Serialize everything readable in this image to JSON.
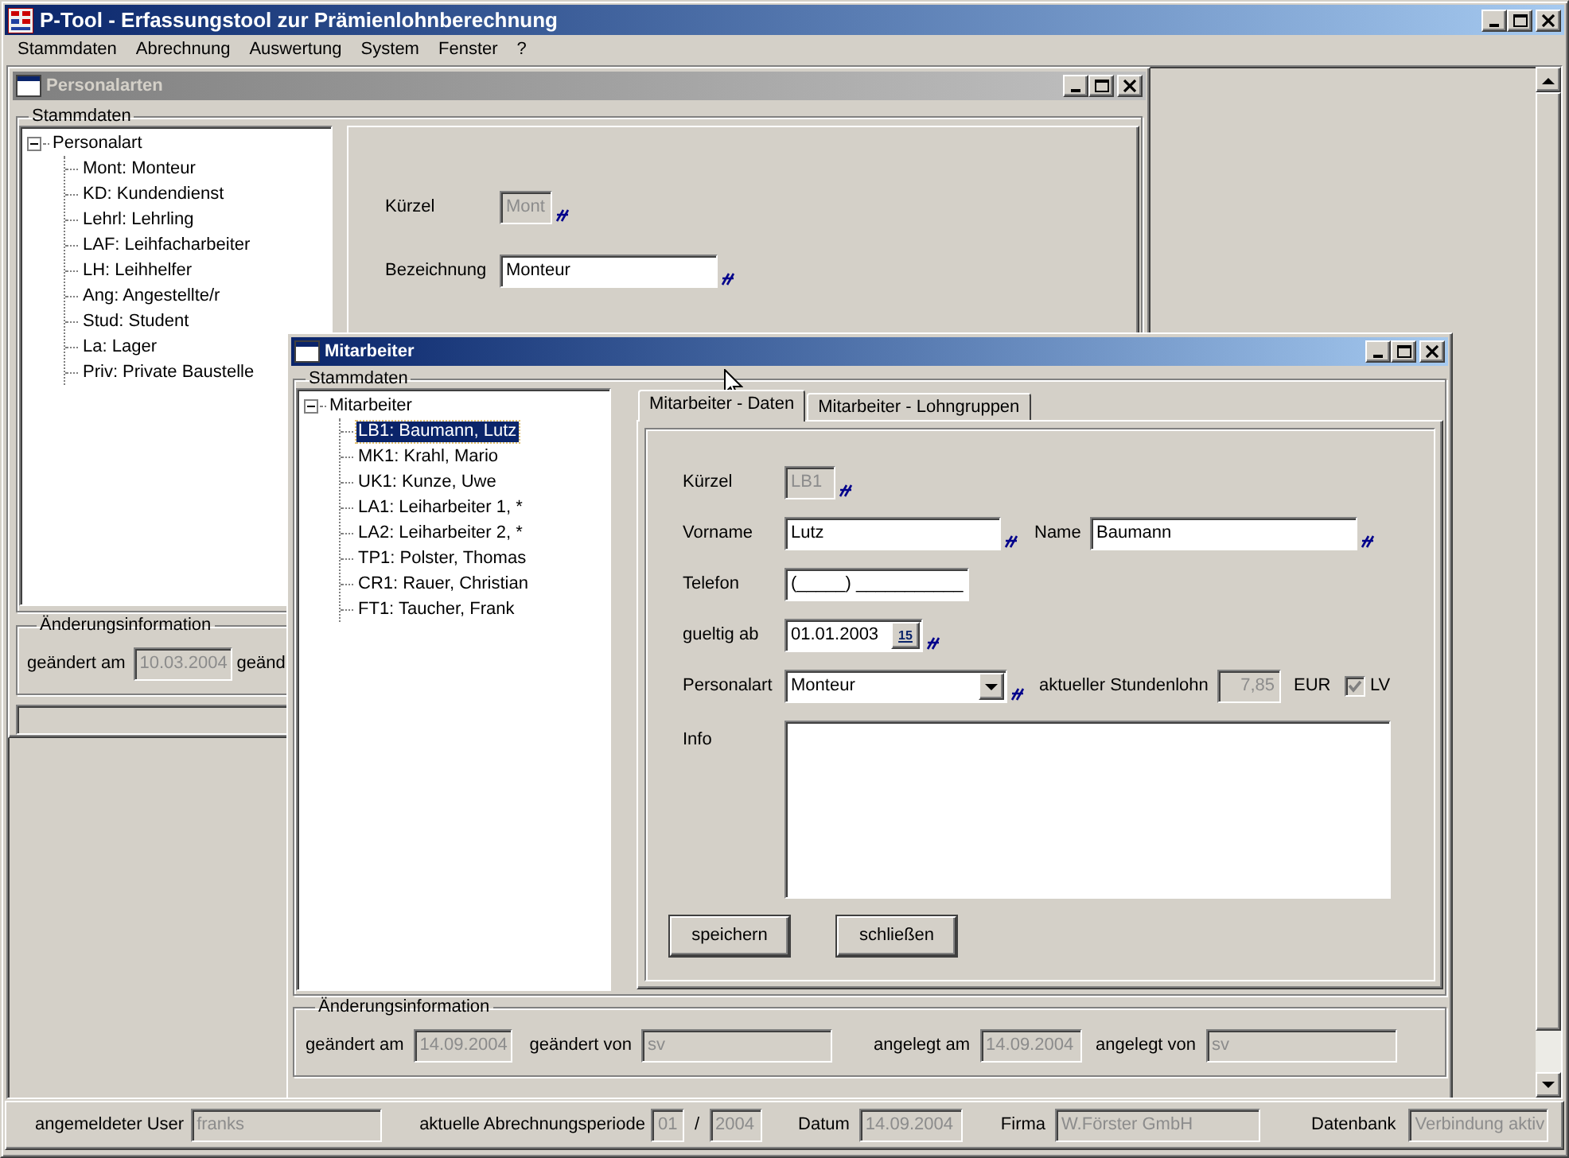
{
  "app": {
    "title": "P-Tool - Erfassungstool zur Prämienlohnberechnung"
  },
  "menu": [
    "Stammdaten",
    "Abrechnung",
    "Auswertung",
    "System",
    "Fenster",
    "?"
  ],
  "personalarten": {
    "title": "Personalarten",
    "active": false,
    "group": "Stammdaten",
    "tree": {
      "label": "Personalart",
      "expanded": true,
      "children": [
        {
          "label": "Mont: Monteur",
          "selected": false
        },
        {
          "label": "KD: Kundendienst",
          "selected": false
        },
        {
          "label": "Lehrl: Lehrling",
          "selected": false
        },
        {
          "label": "LAF: Leihfacharbeiter",
          "selected": false
        },
        {
          "label": "LH: Leihhelfer",
          "selected": false
        },
        {
          "label": "Ang: Angestellte/r",
          "selected": false
        },
        {
          "label": "Stud: Student",
          "selected": false
        },
        {
          "label": "La: Lager",
          "selected": false
        },
        {
          "label": "Priv: Private Baustelle",
          "selected": false
        }
      ]
    },
    "fields": [
      {
        "label": "Kürzel",
        "value": "Mont",
        "disabled": true,
        "required": true
      },
      {
        "label": "Bezeichnung",
        "value": "Monteur",
        "disabled": false,
        "required": true
      }
    ],
    "change_group": "Änderungsinformation",
    "change_fields": [
      {
        "label": "geändert am",
        "value": "10.03.2004",
        "disabled": true
      },
      {
        "label": "geänd"
      }
    ]
  },
  "mitarbeiter": {
    "title": "Mitarbeiter",
    "active": true,
    "group": "Stammdaten",
    "tree": {
      "label": "Mitarbeiter",
      "expanded": true,
      "children": [
        {
          "label": "LB1: Baumann, Lutz",
          "selected": true
        },
        {
          "label": "MK1: Krahl, Mario",
          "selected": false
        },
        {
          "label": "UK1: Kunze, Uwe",
          "selected": false
        },
        {
          "label": "LA1: Leiharbeiter 1, *",
          "selected": false
        },
        {
          "label": "LA2: Leiharbeiter 2, *",
          "selected": false
        },
        {
          "label": "TP1: Polster, Thomas",
          "selected": false
        },
        {
          "label": "CR1: Rauer, Christian",
          "selected": false
        },
        {
          "label": "FT1: Taucher, Frank",
          "selected": false
        }
      ]
    },
    "tabs": [
      {
        "label": "Mitarbeiter - Daten",
        "selected": true
      },
      {
        "label": "Mitarbeiter - Lohngruppen",
        "selected": false
      }
    ],
    "kuerzel": {
      "label": "Kürzel",
      "value": "LB1",
      "disabled": true,
      "required": true
    },
    "vorname": {
      "label": "Vorname",
      "value": "Lutz",
      "disabled": false,
      "required": true
    },
    "name": {
      "label": "Name",
      "value": "Baumann",
      "disabled": false,
      "required": true
    },
    "telefon": {
      "label": "Telefon",
      "value": "(_____) ___________",
      "disabled": false
    },
    "gueltig_ab": {
      "label": "gueltig ab",
      "value": "01.01.2003",
      "disabled": false,
      "required": true,
      "button": "15"
    },
    "personalart": {
      "label": "Personalart",
      "value": "Monteur",
      "required": true
    },
    "stundenlohn": {
      "label": "aktueller Stundenlohn",
      "value": "7,85",
      "disabled": true,
      "unit": "EUR"
    },
    "lv": {
      "label": "LV",
      "checked": true,
      "disabled": true
    },
    "info": {
      "label": "Info"
    },
    "buttons": [
      "speichern",
      "schließen"
    ],
    "change_group": "Änderungsinformation",
    "change_fields": [
      {
        "label": "geändert am",
        "value": "14.09.2004",
        "disabled": true
      },
      {
        "label": "geändert von",
        "value": "sv",
        "disabled": true
      },
      {
        "label": "angelegt am",
        "value": "14.09.2004",
        "disabled": true
      },
      {
        "label": "angelegt von",
        "value": "sv",
        "disabled": true
      }
    ]
  },
  "status_bar": {
    "user": {
      "label": "angemeldeter User",
      "value": "franks",
      "disabled": true
    },
    "period": {
      "label": "aktuelle Abrechnungsperiode",
      "month": "01",
      "separator": "/",
      "year": "2004",
      "disabled": true
    },
    "date": {
      "label": "Datum",
      "value": "14.09.2004",
      "disabled": true
    },
    "company": {
      "label": "Firma",
      "value": "W.Förster GmbH",
      "disabled": true
    },
    "database": {
      "label": "Datenbank",
      "value": "Verbindung aktiv",
      "disabled": true
    }
  }
}
